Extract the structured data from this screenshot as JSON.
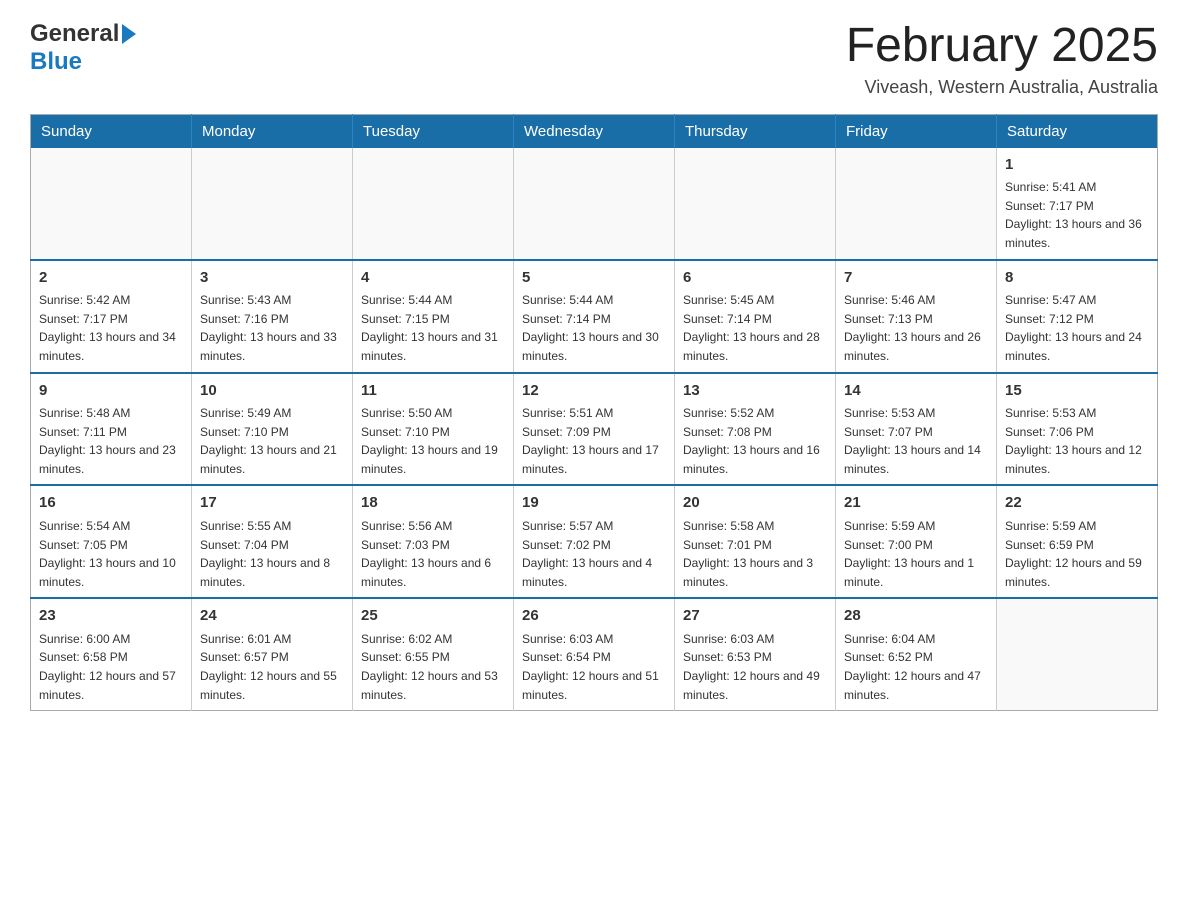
{
  "header": {
    "logo_general": "General",
    "logo_blue": "Blue",
    "month_title": "February 2025",
    "location": "Viveash, Western Australia, Australia"
  },
  "days_of_week": [
    "Sunday",
    "Monday",
    "Tuesday",
    "Wednesday",
    "Thursday",
    "Friday",
    "Saturday"
  ],
  "weeks": [
    [
      {
        "day": "",
        "info": ""
      },
      {
        "day": "",
        "info": ""
      },
      {
        "day": "",
        "info": ""
      },
      {
        "day": "",
        "info": ""
      },
      {
        "day": "",
        "info": ""
      },
      {
        "day": "",
        "info": ""
      },
      {
        "day": "1",
        "info": "Sunrise: 5:41 AM\nSunset: 7:17 PM\nDaylight: 13 hours and 36 minutes."
      }
    ],
    [
      {
        "day": "2",
        "info": "Sunrise: 5:42 AM\nSunset: 7:17 PM\nDaylight: 13 hours and 34 minutes."
      },
      {
        "day": "3",
        "info": "Sunrise: 5:43 AM\nSunset: 7:16 PM\nDaylight: 13 hours and 33 minutes."
      },
      {
        "day": "4",
        "info": "Sunrise: 5:44 AM\nSunset: 7:15 PM\nDaylight: 13 hours and 31 minutes."
      },
      {
        "day": "5",
        "info": "Sunrise: 5:44 AM\nSunset: 7:14 PM\nDaylight: 13 hours and 30 minutes."
      },
      {
        "day": "6",
        "info": "Sunrise: 5:45 AM\nSunset: 7:14 PM\nDaylight: 13 hours and 28 minutes."
      },
      {
        "day": "7",
        "info": "Sunrise: 5:46 AM\nSunset: 7:13 PM\nDaylight: 13 hours and 26 minutes."
      },
      {
        "day": "8",
        "info": "Sunrise: 5:47 AM\nSunset: 7:12 PM\nDaylight: 13 hours and 24 minutes."
      }
    ],
    [
      {
        "day": "9",
        "info": "Sunrise: 5:48 AM\nSunset: 7:11 PM\nDaylight: 13 hours and 23 minutes."
      },
      {
        "day": "10",
        "info": "Sunrise: 5:49 AM\nSunset: 7:10 PM\nDaylight: 13 hours and 21 minutes."
      },
      {
        "day": "11",
        "info": "Sunrise: 5:50 AM\nSunset: 7:10 PM\nDaylight: 13 hours and 19 minutes."
      },
      {
        "day": "12",
        "info": "Sunrise: 5:51 AM\nSunset: 7:09 PM\nDaylight: 13 hours and 17 minutes."
      },
      {
        "day": "13",
        "info": "Sunrise: 5:52 AM\nSunset: 7:08 PM\nDaylight: 13 hours and 16 minutes."
      },
      {
        "day": "14",
        "info": "Sunrise: 5:53 AM\nSunset: 7:07 PM\nDaylight: 13 hours and 14 minutes."
      },
      {
        "day": "15",
        "info": "Sunrise: 5:53 AM\nSunset: 7:06 PM\nDaylight: 13 hours and 12 minutes."
      }
    ],
    [
      {
        "day": "16",
        "info": "Sunrise: 5:54 AM\nSunset: 7:05 PM\nDaylight: 13 hours and 10 minutes."
      },
      {
        "day": "17",
        "info": "Sunrise: 5:55 AM\nSunset: 7:04 PM\nDaylight: 13 hours and 8 minutes."
      },
      {
        "day": "18",
        "info": "Sunrise: 5:56 AM\nSunset: 7:03 PM\nDaylight: 13 hours and 6 minutes."
      },
      {
        "day": "19",
        "info": "Sunrise: 5:57 AM\nSunset: 7:02 PM\nDaylight: 13 hours and 4 minutes."
      },
      {
        "day": "20",
        "info": "Sunrise: 5:58 AM\nSunset: 7:01 PM\nDaylight: 13 hours and 3 minutes."
      },
      {
        "day": "21",
        "info": "Sunrise: 5:59 AM\nSunset: 7:00 PM\nDaylight: 13 hours and 1 minute."
      },
      {
        "day": "22",
        "info": "Sunrise: 5:59 AM\nSunset: 6:59 PM\nDaylight: 12 hours and 59 minutes."
      }
    ],
    [
      {
        "day": "23",
        "info": "Sunrise: 6:00 AM\nSunset: 6:58 PM\nDaylight: 12 hours and 57 minutes."
      },
      {
        "day": "24",
        "info": "Sunrise: 6:01 AM\nSunset: 6:57 PM\nDaylight: 12 hours and 55 minutes."
      },
      {
        "day": "25",
        "info": "Sunrise: 6:02 AM\nSunset: 6:55 PM\nDaylight: 12 hours and 53 minutes."
      },
      {
        "day": "26",
        "info": "Sunrise: 6:03 AM\nSunset: 6:54 PM\nDaylight: 12 hours and 51 minutes."
      },
      {
        "day": "27",
        "info": "Sunrise: 6:03 AM\nSunset: 6:53 PM\nDaylight: 12 hours and 49 minutes."
      },
      {
        "day": "28",
        "info": "Sunrise: 6:04 AM\nSunset: 6:52 PM\nDaylight: 12 hours and 47 minutes."
      },
      {
        "day": "",
        "info": ""
      }
    ]
  ]
}
